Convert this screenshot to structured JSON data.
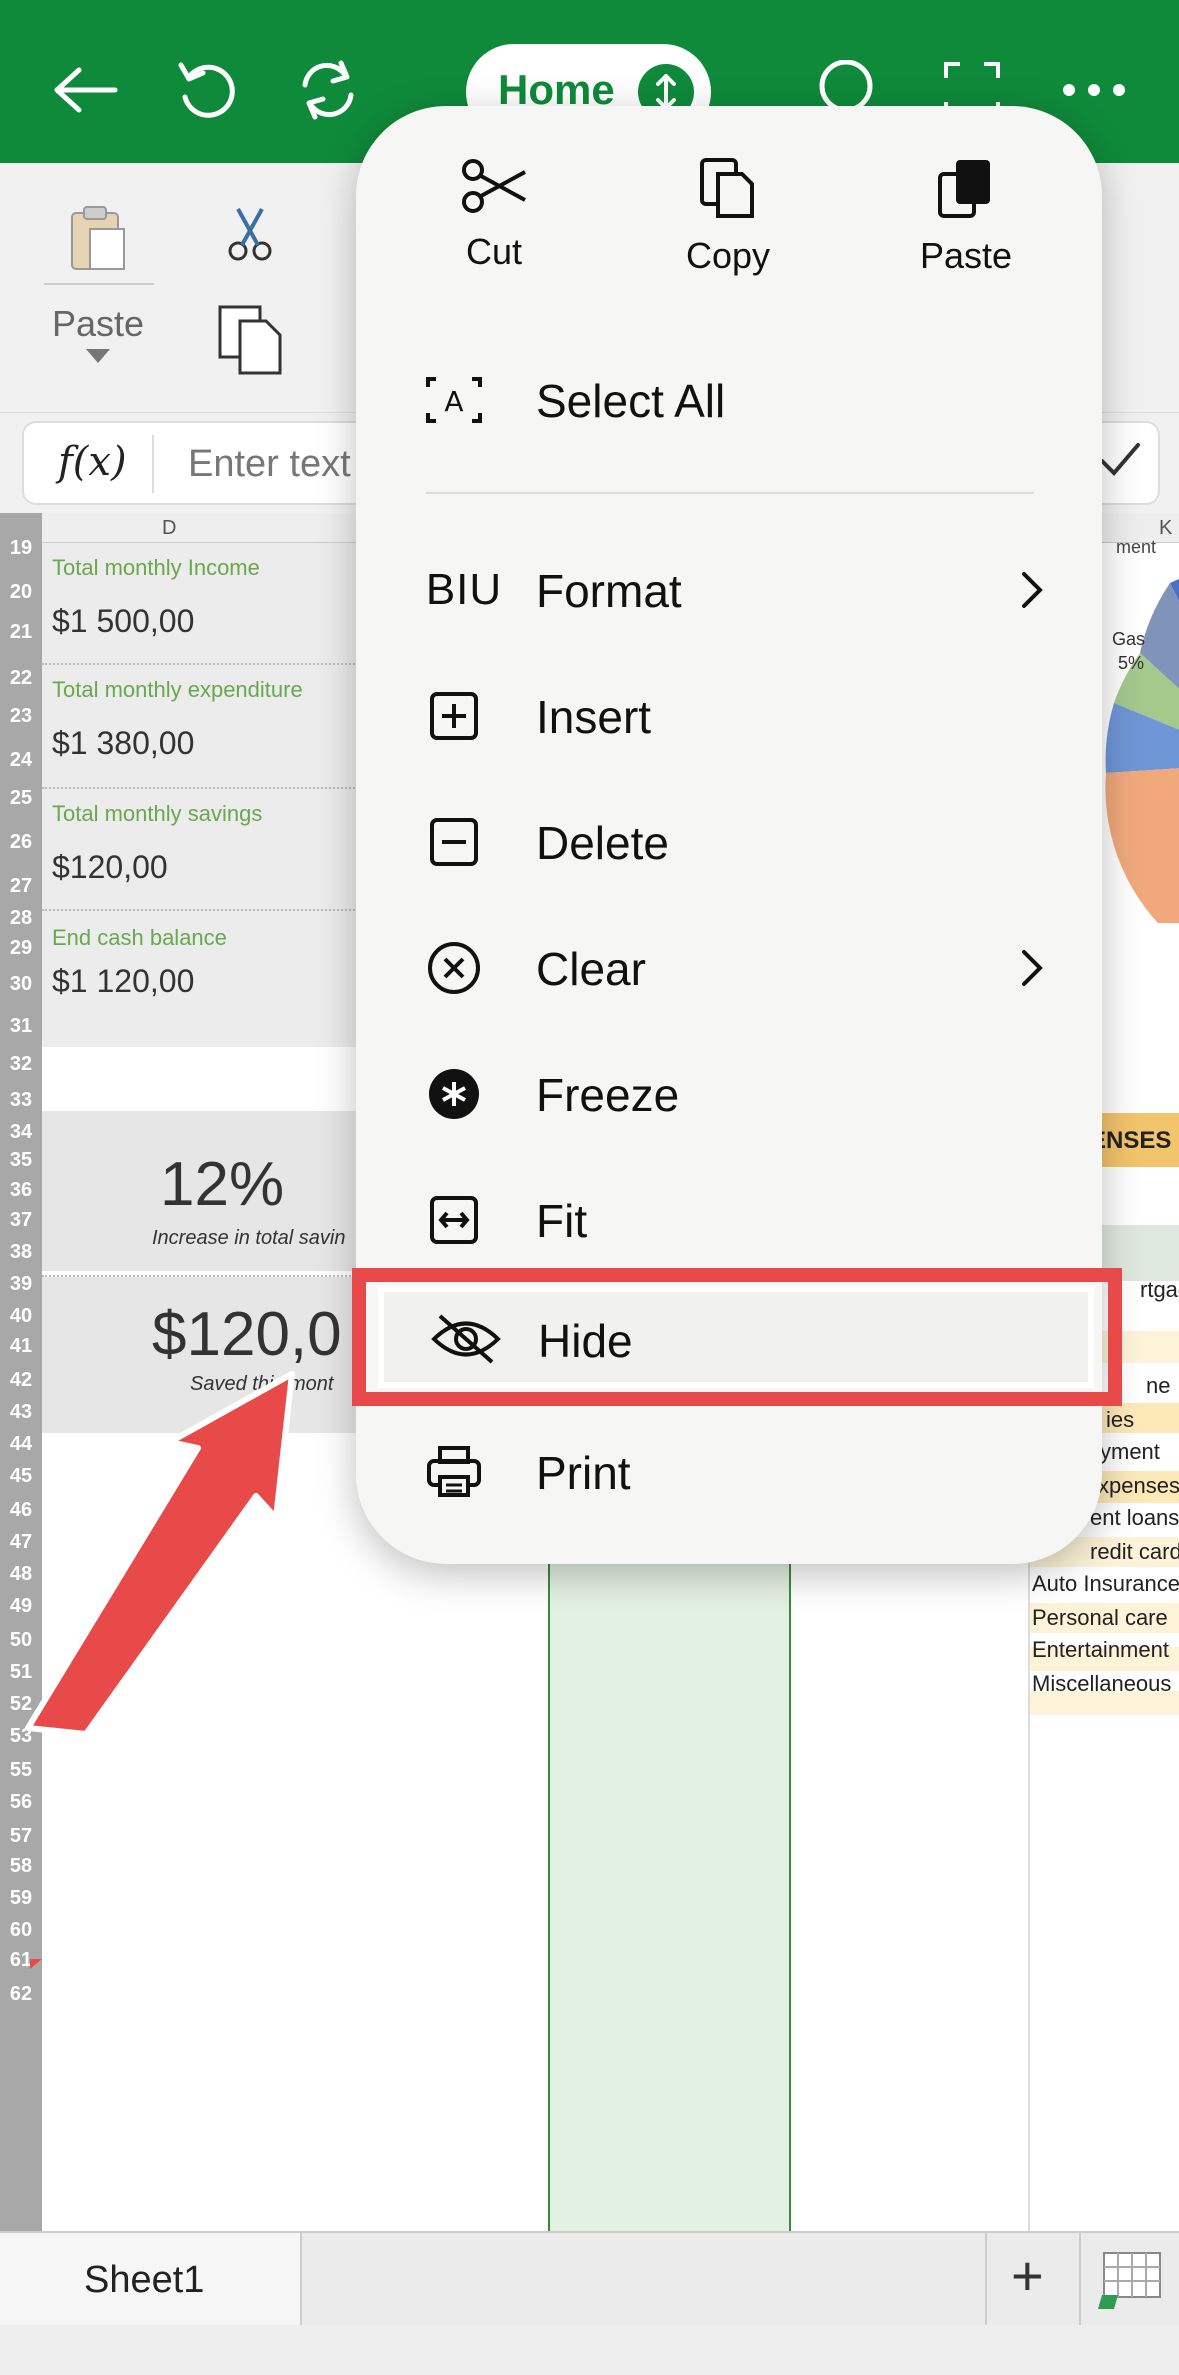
{
  "toolbar": {
    "tab_label": "Home"
  },
  "ribbon": {
    "paste_label": "Paste"
  },
  "formula_bar": {
    "fx_label": "f(x)",
    "placeholder": "Enter text"
  },
  "sheet": {
    "column_headers": [
      "D",
      "K"
    ],
    "row_numbers": [
      "19",
      "20",
      "21",
      "22",
      "23",
      "24",
      "25",
      "26",
      "27",
      "28",
      "29",
      "30",
      "31",
      "32",
      "33",
      "34",
      "35",
      "36",
      "37",
      "38",
      "39",
      "40",
      "41",
      "42",
      "43",
      "44",
      "45",
      "46",
      "47",
      "48",
      "49",
      "50",
      "51",
      "52",
      "53",
      "55",
      "56",
      "57",
      "58",
      "59",
      "60",
      "61",
      "62"
    ],
    "summary": [
      {
        "label": "Total monthly Income",
        "value": "$1 500,00"
      },
      {
        "label": "Total monthly expenditure",
        "value": "$1 380,00"
      },
      {
        "label": "Total monthly savings",
        "value": "$120,00"
      },
      {
        "label": "End cash balance",
        "value": "$1 120,00"
      }
    ],
    "kpi1": {
      "value": "12%",
      "caption": "Increase in total savin"
    },
    "kpi2": {
      "value": "$120,0",
      "caption": "Saved this mont"
    },
    "pie_label": "Gas",
    "pie_pct": "5%",
    "pie_top_label": "ment",
    "expenses_header": "ENSES",
    "expense_items": [
      "rtgage",
      "ne",
      "ies",
      "yment",
      "xpenses",
      "ent loans",
      "redit cards",
      "Auto Insurance",
      "Personal care",
      "Entertainment",
      "Miscellaneous"
    ]
  },
  "tabs": {
    "sheet_name": "Sheet1",
    "add_label": "+"
  },
  "context_menu": {
    "clipboard": {
      "cut": "Cut",
      "copy": "Copy",
      "paste": "Paste"
    },
    "format_icon_text": "BIU",
    "items": [
      {
        "label": "Select All"
      },
      {
        "label": "Format"
      },
      {
        "label": "Insert"
      },
      {
        "label": "Delete"
      },
      {
        "label": "Clear"
      },
      {
        "label": "Freeze"
      },
      {
        "label": "Fit"
      },
      {
        "label": "Hide"
      },
      {
        "label": "Print"
      }
    ]
  },
  "colors": {
    "brand_green": "#0f8a3a",
    "highlight_red": "#e84a4a",
    "label_green": "#6aa84f"
  }
}
